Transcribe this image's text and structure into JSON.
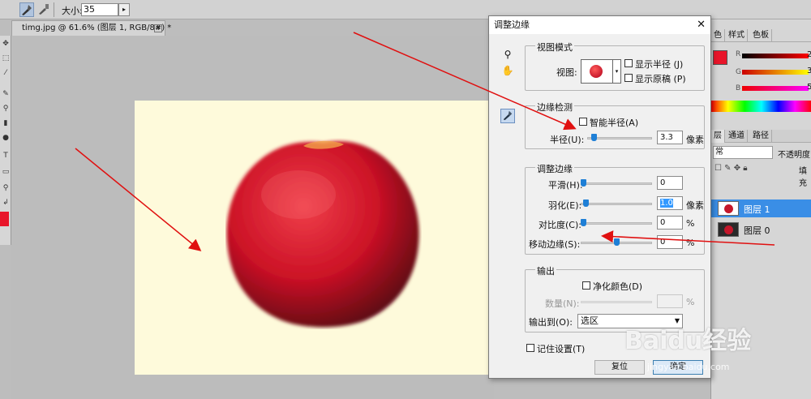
{
  "options_bar": {
    "size_label": "大小:",
    "size_value": "35"
  },
  "document": {
    "tab_title": "timg.jpg @ 61.6% (图层 1, RGB/8#) *",
    "close_glyph": "✕"
  },
  "dialog": {
    "title": "调整边缘",
    "close_glyph": "✕",
    "view_mode": {
      "heading": "视图模式",
      "view_label": "视图:",
      "show_radius": "显示半径 (J)",
      "show_original": "显示原稿 (P)"
    },
    "edge_detection": {
      "heading": "边缘检测",
      "smart_radius": "智能半径(A)",
      "radius_label": "半径(U):",
      "radius_value": "3.3",
      "radius_unit": "像素"
    },
    "adjust_edge": {
      "heading": "调整边缘",
      "smooth_label": "平滑(H):",
      "smooth_value": "0",
      "feather_label": "羽化(E):",
      "feather_value": "1.0",
      "feather_unit": "像素",
      "contrast_label": "对比度(C):",
      "contrast_value": "0",
      "contrast_unit": "%",
      "shift_label": "移动边缘(S):",
      "shift_value": "0",
      "shift_unit": "%"
    },
    "output": {
      "heading": "输出",
      "decontaminate": "净化颜色(D)",
      "amount_label": "数量(N):",
      "amount_unit": "%",
      "output_to_label": "输出到(O):",
      "output_to_value": "选区"
    },
    "remember": "记住设置(T)",
    "reset_button": "复位",
    "ok_button": "确定"
  },
  "right_panel": {
    "tabs": [
      "色",
      "样式",
      "色板"
    ],
    "color_letters": [
      "R",
      "G",
      "B"
    ],
    "color_values": [
      "2",
      "3",
      "5"
    ],
    "layers_tabs": [
      "层",
      "通道",
      "路径"
    ],
    "blend_mode": "常",
    "opacity_label": "不透明度",
    "lock_label": "填充",
    "layers": [
      {
        "name": "图层 1",
        "selected": true
      },
      {
        "name": "图层 0",
        "selected": false
      }
    ]
  },
  "watermark": {
    "text": "Baidu经验",
    "url": "jingyan.baidu.com"
  }
}
